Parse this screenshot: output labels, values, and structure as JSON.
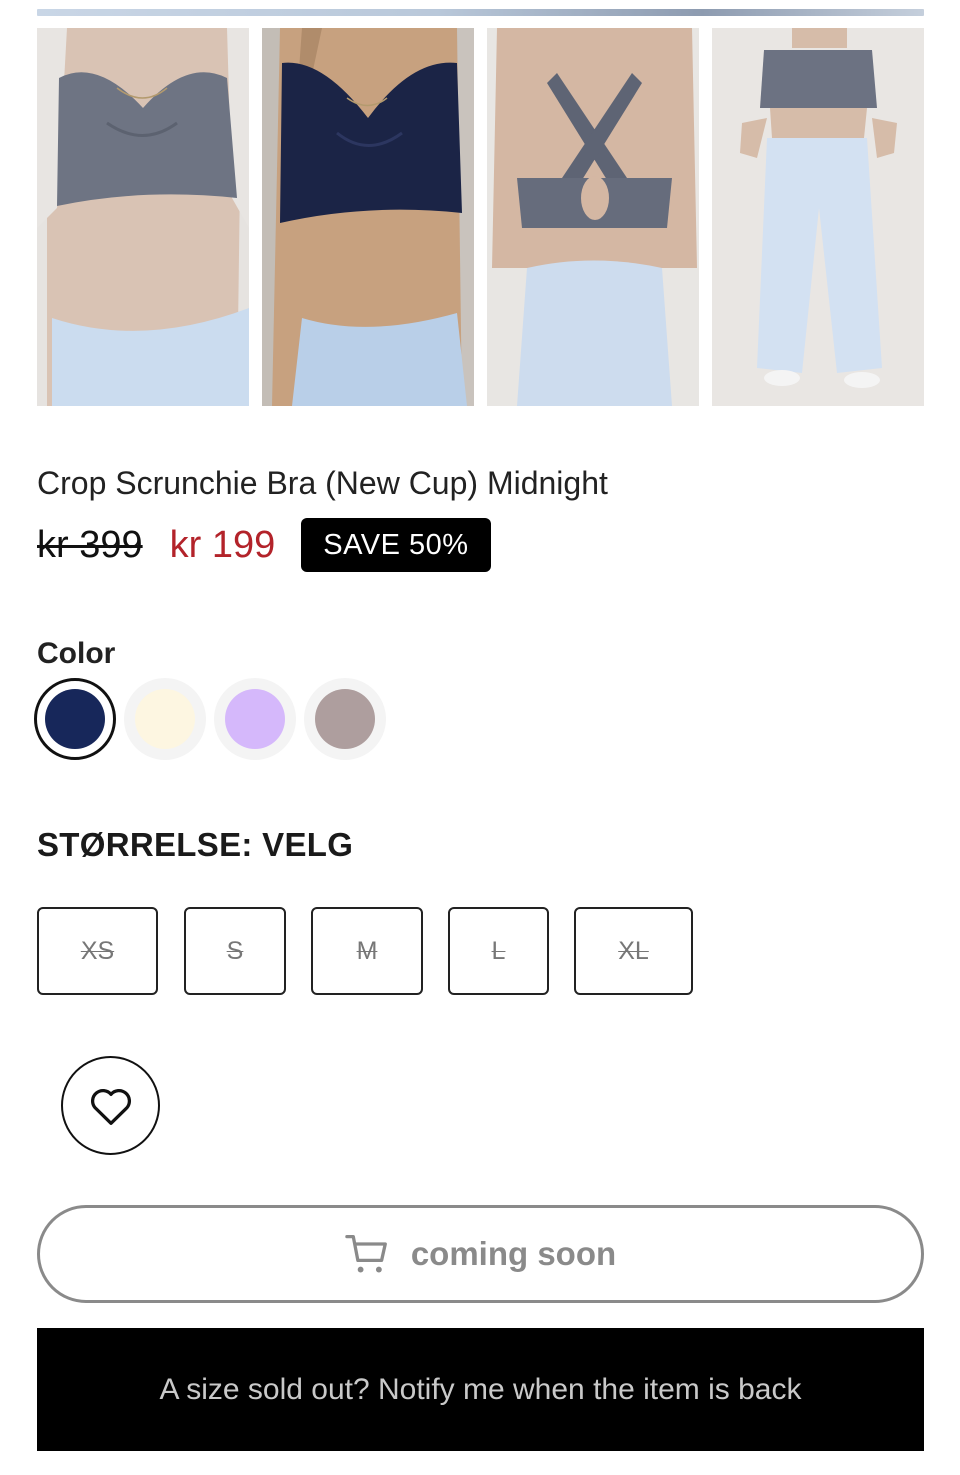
{
  "product": {
    "title": "Crop Scrunchie Bra (New Cup) Midnight",
    "price_old": "kr 399",
    "price_new": "kr 199",
    "badge": "SAVE 50%"
  },
  "gallery": {
    "images": [
      {
        "name": "product-image-front-grey"
      },
      {
        "name": "product-image-front-midnight"
      },
      {
        "name": "product-image-back"
      },
      {
        "name": "product-image-full-body"
      }
    ]
  },
  "color": {
    "label": "Color",
    "options": [
      {
        "hex": "#17275a",
        "selected": true
      },
      {
        "hex": "#fdf6e1",
        "selected": false
      },
      {
        "hex": "#d5b8fb",
        "selected": false
      },
      {
        "hex": "#ae9e9e",
        "selected": false
      }
    ]
  },
  "size": {
    "label": "STØRRELSE: VELG",
    "options": [
      "XS",
      "S",
      "M",
      "L",
      "XL"
    ]
  },
  "actions": {
    "wishlist_icon": "heart-icon",
    "cart_icon": "cart-icon",
    "cart_label": "coming soon",
    "notify_label": "A size sold out? Notify me when the item is back"
  }
}
